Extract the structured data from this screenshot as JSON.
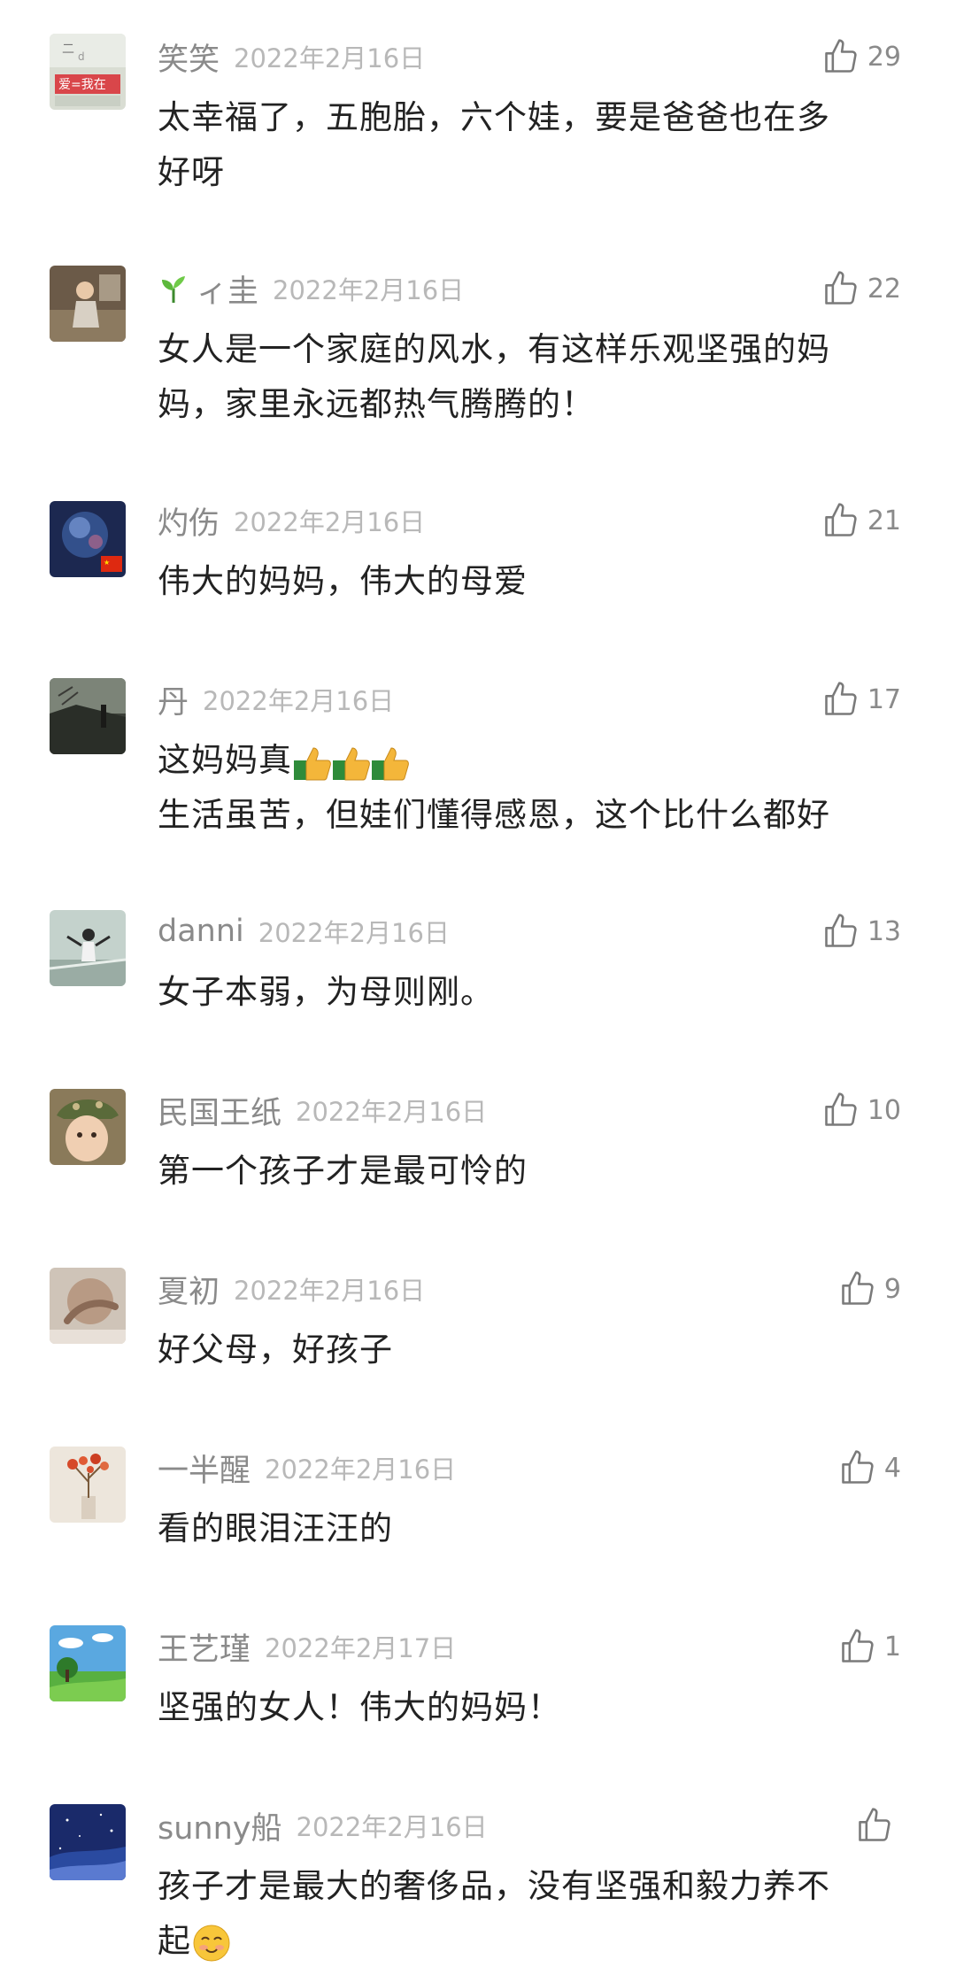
{
  "comments": [
    {
      "user": "笑笑",
      "date": "2022年2月16日",
      "likes": "29",
      "lines": [
        "太幸福了，五胞胎，六个娃，要是爸爸也在多",
        "好呀"
      ],
      "avatar_text": "爱=我在"
    },
    {
      "user": "ィ圭",
      "date": "2022年2月16日",
      "likes": "22",
      "lines": [
        "女人是一个家庭的风水，有这样乐观坚强的妈",
        "妈，家里永远都热气腾腾的！"
      ]
    },
    {
      "user": "灼伤",
      "date": "2022年2月16日",
      "likes": "21",
      "lines": [
        "伟大的妈妈，伟大的母爱"
      ]
    },
    {
      "user": "丹",
      "date": "2022年2月16日",
      "likes": "17",
      "lines": [
        "这妈妈真",
        "生活虽苦，但娃们懂得感恩，这个比什么都好"
      ]
    },
    {
      "user": "danni",
      "date": "2022年2月16日",
      "likes": "13",
      "lines": [
        "女子本弱，为母则刚。"
      ]
    },
    {
      "user": "民国王纸",
      "date": "2022年2月16日",
      "likes": "10",
      "lines": [
        "第一个孩子才是最可怜的"
      ]
    },
    {
      "user": "夏初",
      "date": "2022年2月16日",
      "likes": "9",
      "lines": [
        "好父母，好孩子"
      ]
    },
    {
      "user": "一半醒",
      "date": "2022年2月16日",
      "likes": "4",
      "lines": [
        "看的眼泪汪汪的"
      ]
    },
    {
      "user": "王艺瑾",
      "date": "2022年2月17日",
      "likes": "1",
      "lines": [
        "坚强的女人！伟大的妈妈！"
      ]
    },
    {
      "user": "sunny船",
      "date": "2022年2月16日",
      "likes": "",
      "lines": [
        "孩子才是最大的奢侈品，没有坚强和毅力养不",
        "起"
      ]
    }
  ],
  "icons": {
    "like": "thumbs-up-outline-icon",
    "sprout": "seedling-icon",
    "thumbs_emoji": "thumbs-up-emoji",
    "smile_emoji": "smiling-face-emoji"
  },
  "colors": {
    "username": "#8a8a8a",
    "date": "#b8b8b8",
    "text": "#222222",
    "like_icon": "#7a7a7a"
  }
}
